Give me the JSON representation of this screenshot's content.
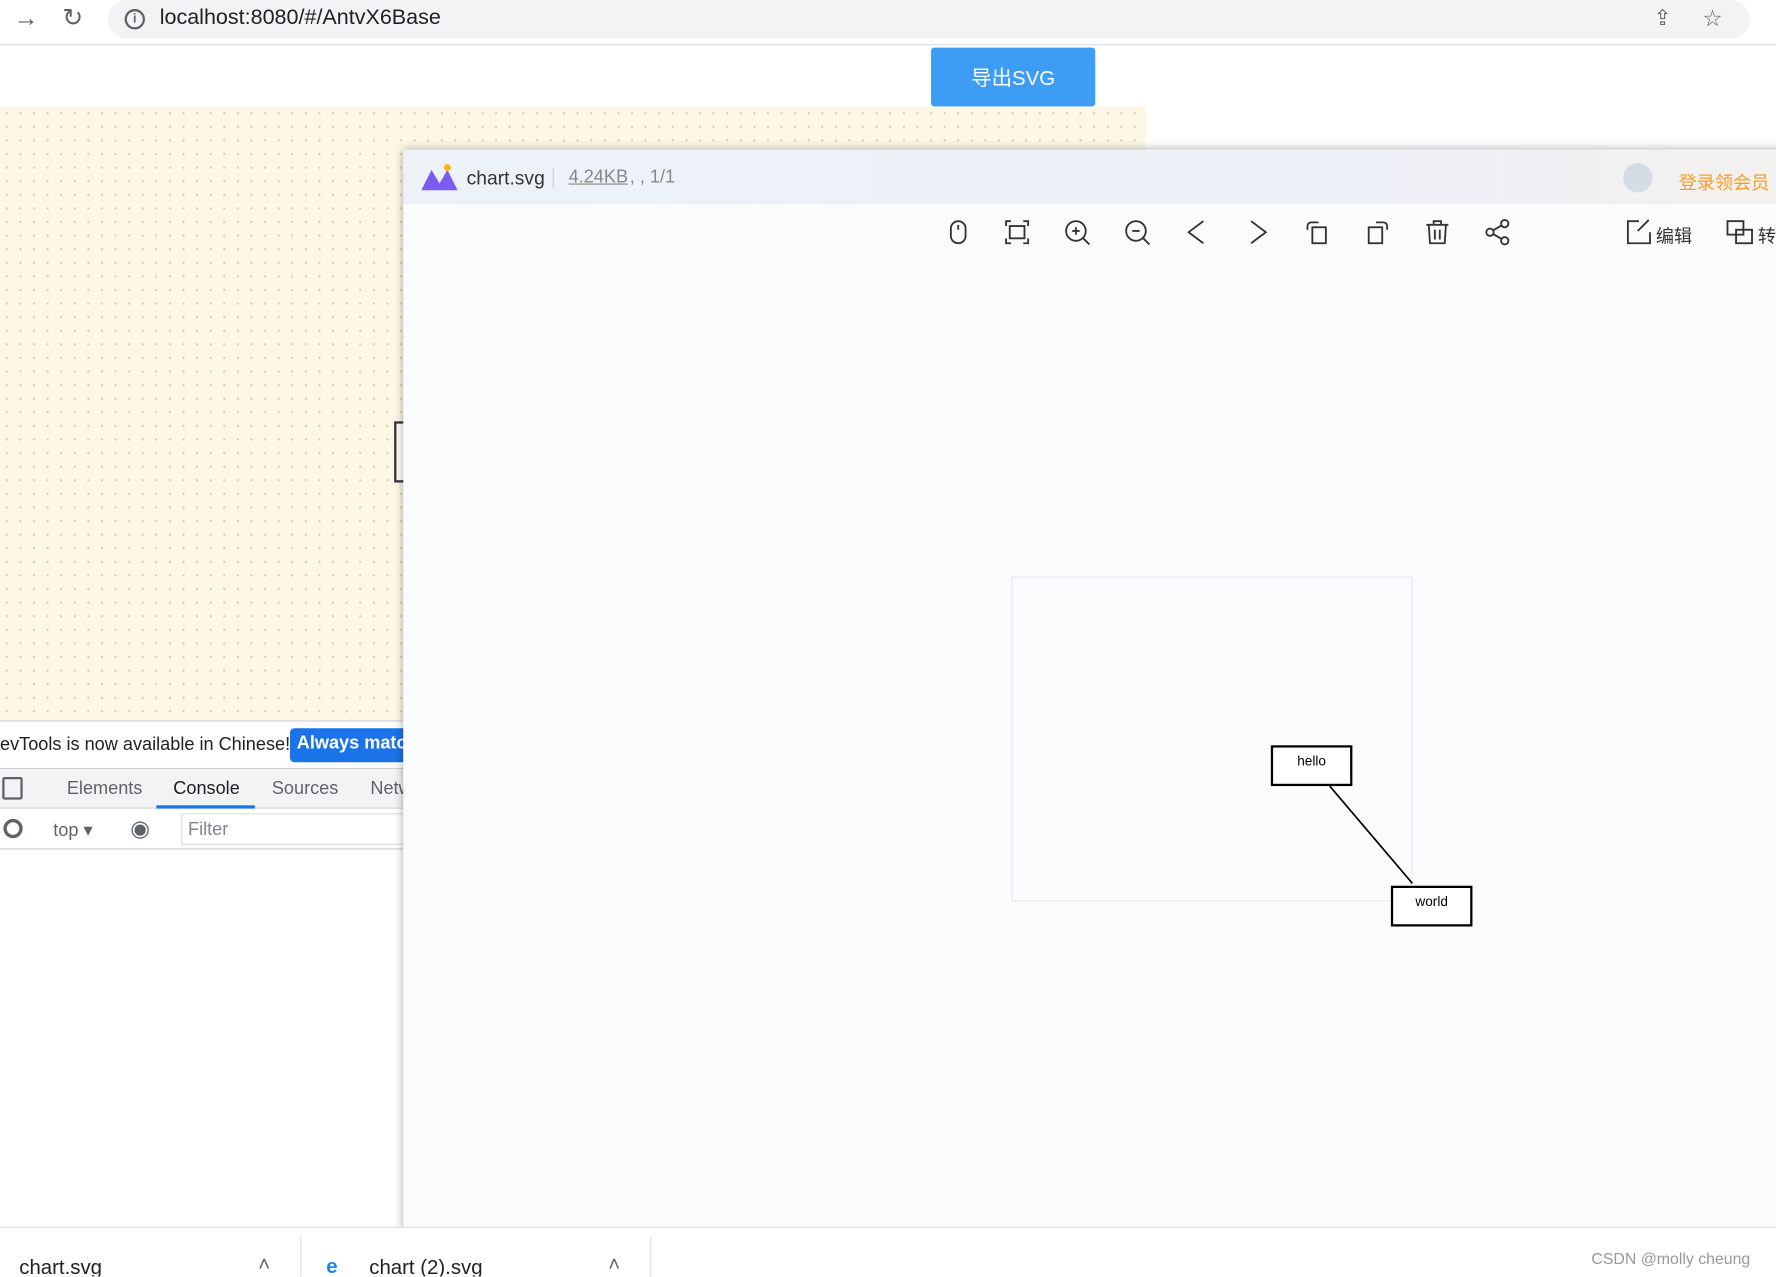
{
  "browser": {
    "url": "localhost:8080/#/AntvX6Base"
  },
  "page": {
    "export_button": "导出SVG"
  },
  "devtools": {
    "banner_text": "evTools is now available in Chinese!",
    "banner_button": "Always match",
    "tabs": [
      "Elements",
      "Console",
      "Sources",
      "Netw"
    ],
    "active_tab": "Console",
    "context": "top",
    "filter_placeholder": "Filter"
  },
  "viewer": {
    "filename": "chart.svg",
    "filesize": "4.24KB",
    "meta": ", , 1/1",
    "login": "登录领会员",
    "edit": "编辑",
    "convert": "转",
    "accent": "#ff9a1f",
    "nodes": {
      "hello": "hello",
      "world": "world"
    }
  },
  "downloads": [
    {
      "name": "chart.svg"
    },
    {
      "name": "chart (2).svg"
    }
  ],
  "watermark": "CSDN @molly cheung"
}
